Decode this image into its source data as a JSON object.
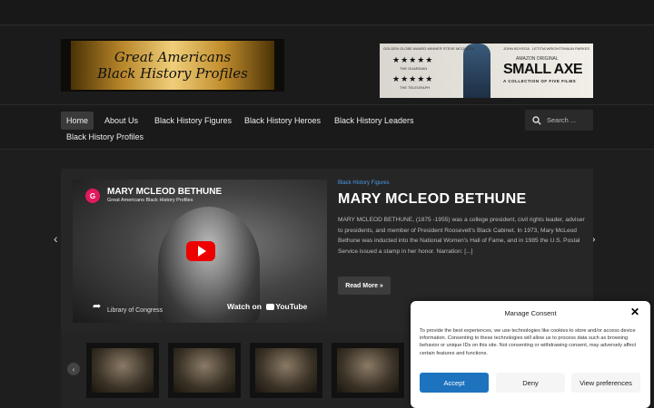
{
  "site": {
    "logo_line1": "Great Americans",
    "logo_line2": "Black History Profiles"
  },
  "ad": {
    "top_left": "GOLDEN GLOBE AWARD WINNER STEVE MCQUEEN",
    "cast": [
      "JOHN BOYEGA",
      "LETITIA WRIGHT",
      "SHAUN PARKES"
    ],
    "stars": "★★★★★",
    "source1": "THE GUARDIAN",
    "source2": "THE TELEGRAPH",
    "badge": "AMAZON ORIGINAL",
    "title": "SMALL AXE",
    "subtitle": "A COLLECTION OF FIVE FILMS"
  },
  "nav": {
    "items": [
      "Home",
      "About Us",
      "Black History Figures",
      "Black History Heroes",
      "Black History Leaders",
      "Black History Profiles"
    ],
    "search_placeholder": "Search ..."
  },
  "video": {
    "avatar_letter": "G",
    "title": "MARY MCLEOD BETHUNE",
    "channel": "Great Americans Black History Profiles",
    "credit": "Library of Congress",
    "watch_label": "Watch on",
    "watch_brand": "YouTube"
  },
  "post": {
    "category": "Black History Figures",
    "title": "MARY MCLEOD BETHUNE",
    "excerpt": "MARY MCLEOD BETHUNE, (1875 -1955) was a college president, civil rights leader, adviser to presidents, and member of President Roosevelt's Black Cabinet. In 1973, Mary McLeod Bethune was inducted into the National Women's Hall of Fame, and in 1985 the U.S. Postal Service issued a stamp in her honor. Narration: [...]",
    "read_more": "Read More »"
  },
  "consent": {
    "title": "Manage Consent",
    "text": "To provide the best experiences, we use technologies like cookies to store and/or access device information. Consenting to these technologies will allow us to process data such as browsing behavior or unique IDs on this site. Not consenting or withdrawing consent, may adversely affect certain features and functions.",
    "accept": "Accept",
    "deny": "Deny",
    "preferences": "View preferences"
  }
}
